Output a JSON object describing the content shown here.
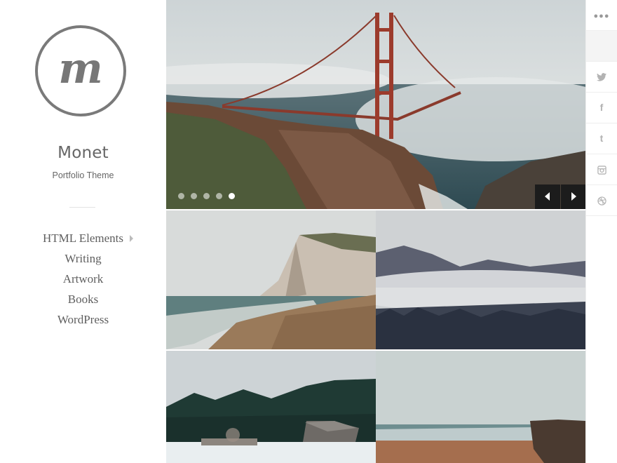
{
  "site": {
    "logo_letter": "m",
    "title": "Monet",
    "tagline": "Portfolio Theme"
  },
  "nav": {
    "items": [
      {
        "label": "HTML Elements",
        "has_submenu": true
      },
      {
        "label": "Writing"
      },
      {
        "label": "Artwork"
      },
      {
        "label": "Books"
      },
      {
        "label": "WordPress"
      }
    ]
  },
  "slider": {
    "slide_count": 5,
    "active_slide": 5,
    "image": "golden-gate-bridge-in-fog"
  },
  "gallery": {
    "tiles": [
      {
        "image": "coastal-cliff-beach"
      },
      {
        "image": "foggy-forest-hills"
      },
      {
        "image": "snowy-cabin-forest"
      },
      {
        "image": "misty-shoreline-rocks"
      }
    ]
  },
  "social": {
    "items": [
      {
        "icon": "more-dots-icon"
      },
      {
        "icon": "blank-icon"
      },
      {
        "icon": "twitter-icon"
      },
      {
        "icon": "facebook-icon"
      },
      {
        "icon": "tumblr-icon"
      },
      {
        "icon": "instagram-icon"
      },
      {
        "icon": "dribbble-icon"
      }
    ]
  },
  "colors": {
    "text": "#666666",
    "arrow_bg": "#1c1c1c",
    "social_icon": "#b3b3b3"
  }
}
